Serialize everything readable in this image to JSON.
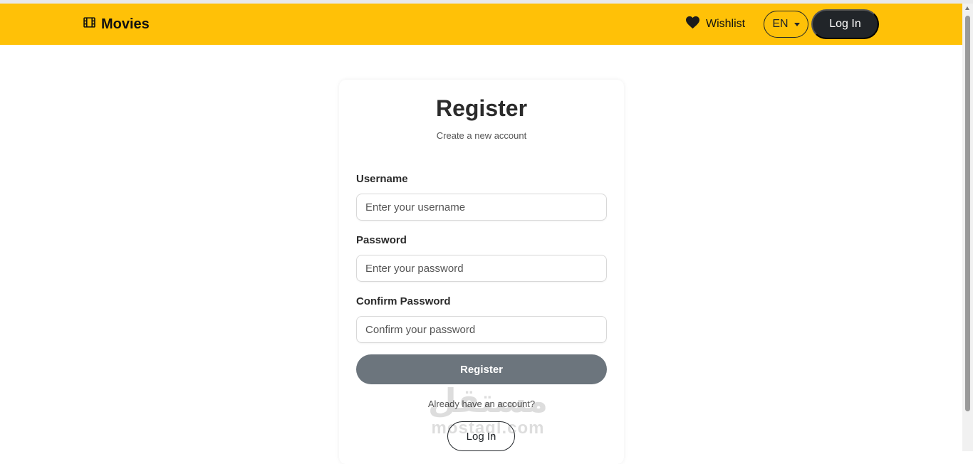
{
  "navbar": {
    "brand": "Movies",
    "wishlist": "Wishlist",
    "language": "EN",
    "login": "Log In"
  },
  "form": {
    "title": "Register",
    "subtitle": "Create a new account",
    "username_label": "Username",
    "username_placeholder": "Enter your username",
    "password_label": "Password",
    "password_placeholder": "Enter your password",
    "confirm_label": "Confirm Password",
    "confirm_placeholder": "Confirm your password",
    "register_button": "Register",
    "already_text": "Already have an account?",
    "login_button": "Log In"
  },
  "watermark": {
    "arabic": "مستقل",
    "latin": "mostaql.com"
  },
  "colors": {
    "navbar": "#ffc107",
    "dark": "#212529",
    "register_button": "#6c757d"
  },
  "icons": {
    "brand": "film-icon",
    "wishlist": "heart-icon",
    "language": "caret-down-icon"
  }
}
